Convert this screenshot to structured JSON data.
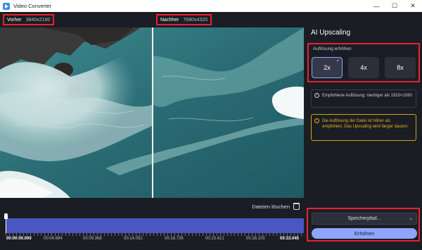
{
  "window": {
    "title": "Video Converter",
    "minimize": "—",
    "maximize": "☐",
    "close": "✕"
  },
  "preview": {
    "before": {
      "label": "Vorher",
      "resolution": "3840x2160"
    },
    "after": {
      "label": "Nachher",
      "resolution": "7680x4320"
    }
  },
  "timeline": {
    "delete_label": "Dateien löschen",
    "timecodes": [
      "00:00:00.000",
      "00:04.684",
      "00:09.368",
      "00:14.052",
      "00:18.736",
      "00:23.421",
      "00:28.105",
      "00:33.045"
    ]
  },
  "panel": {
    "title": "AI Upscaling",
    "scale_label": "Auflösung erhöhen",
    "options": [
      {
        "label": "2x",
        "selected": true
      },
      {
        "label": "4x",
        "selected": false
      },
      {
        "label": "8x",
        "selected": false
      }
    ],
    "info_text": "Empfohlene Auflösung: niedriger als 1920×1080",
    "warning_text": "Die Auflösung der Datei ist höher als empfohlen. Das Upscaling wird länger dauern.",
    "save_path": "Speicherpfad...",
    "convert_label": "Erhöhen"
  },
  "colors": {
    "accent": "#8ea5ff",
    "highlight": "#e8232f",
    "warning": "#e6b31a",
    "timeline": "#4a56c2"
  }
}
